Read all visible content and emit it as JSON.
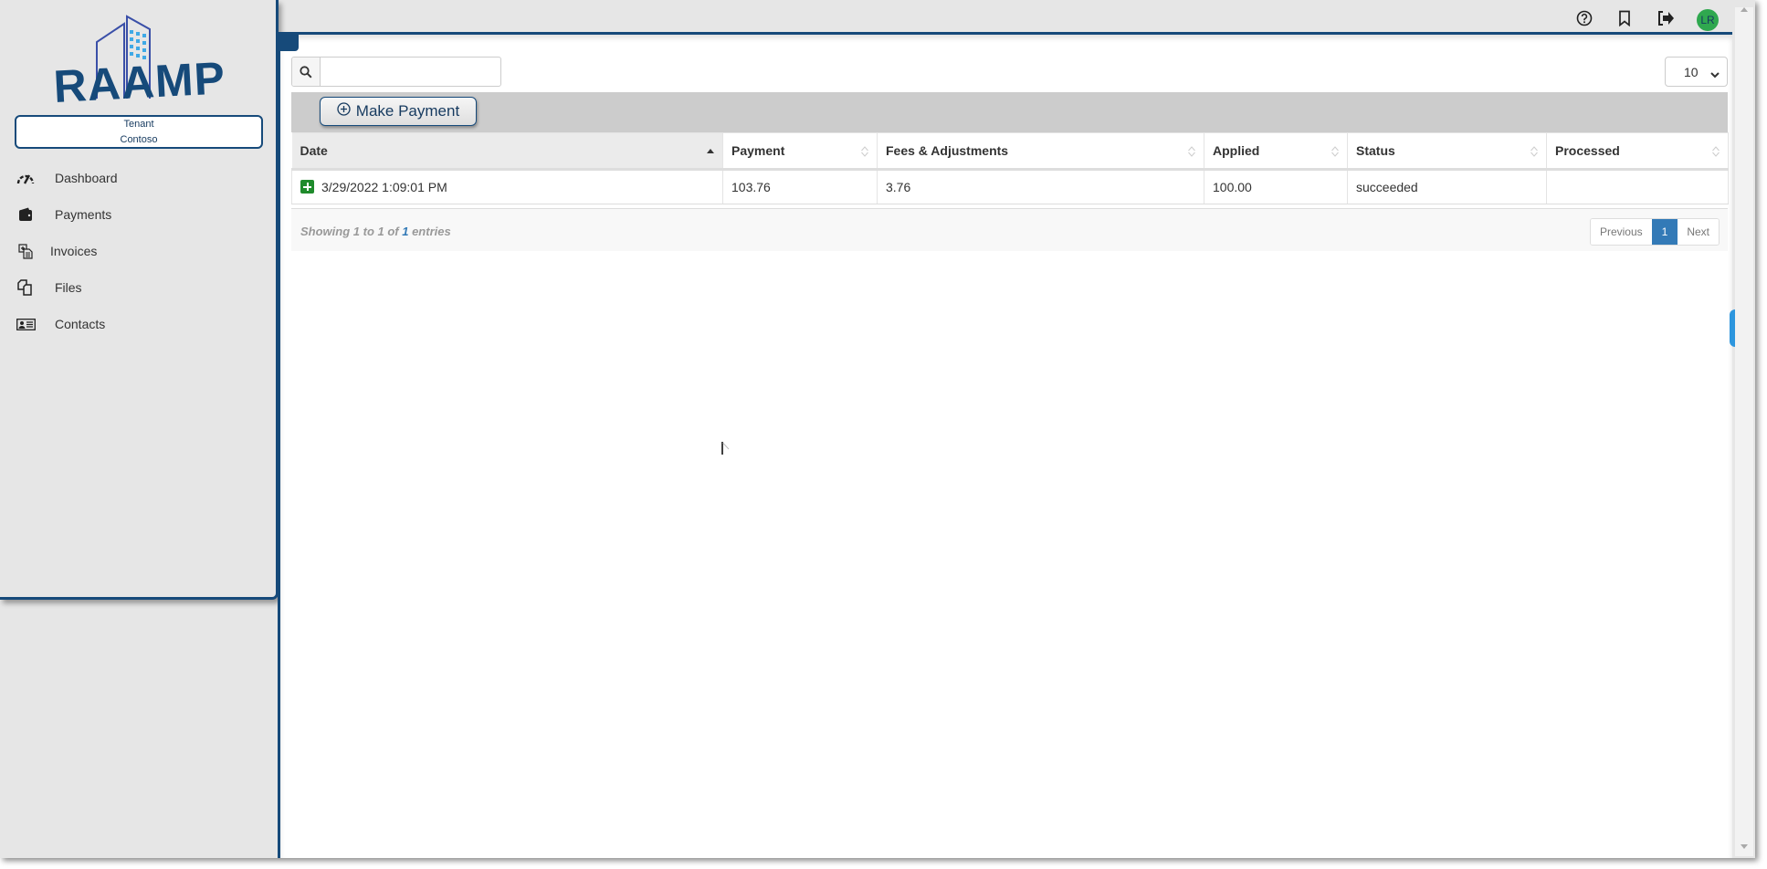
{
  "app": {
    "logo_text": "RAAMP",
    "role": "Tenant",
    "organization": "Contoso",
    "brand_color": "#164a7a"
  },
  "topbar": {
    "icons": [
      "help-icon",
      "bookmark-icon",
      "sign-out-icon"
    ],
    "avatar_initials": "LR",
    "avatar_color": "#2fa84f"
  },
  "sidebar": {
    "items": [
      {
        "label": "Dashboard",
        "icon": "gauge-icon"
      },
      {
        "label": "Payments",
        "icon": "wallet-icon"
      },
      {
        "label": "Invoices",
        "icon": "invoices-icon"
      },
      {
        "label": "Files",
        "icon": "files-icon"
      },
      {
        "label": "Contacts",
        "icon": "contact-card-icon"
      }
    ]
  },
  "main": {
    "search": {
      "value": "",
      "placeholder": ""
    },
    "page_size": {
      "selected": "10"
    },
    "toolbar": {
      "make_payment_label": "Make Payment"
    },
    "table": {
      "columns": [
        {
          "label": "Date",
          "sort": "ascending"
        },
        {
          "label": "Payment",
          "sort": "none"
        },
        {
          "label": "Fees & Adjustments",
          "sort": "none"
        },
        {
          "label": "Applied",
          "sort": "none"
        },
        {
          "label": "Status",
          "sort": "none"
        },
        {
          "label": "Processed",
          "sort": "none"
        }
      ],
      "rows": [
        {
          "date": "3/29/2022 1:09:01 PM",
          "payment": "103.76",
          "fees": "3.76",
          "applied": "100.00",
          "status": "succeeded",
          "processed": ""
        }
      ]
    },
    "footer": {
      "info_prefix": "Showing 1 to 1 of ",
      "info_total": "1",
      "info_suffix": " entries",
      "pager": {
        "previous": "Previous",
        "current": "1",
        "next": "Next"
      }
    }
  }
}
